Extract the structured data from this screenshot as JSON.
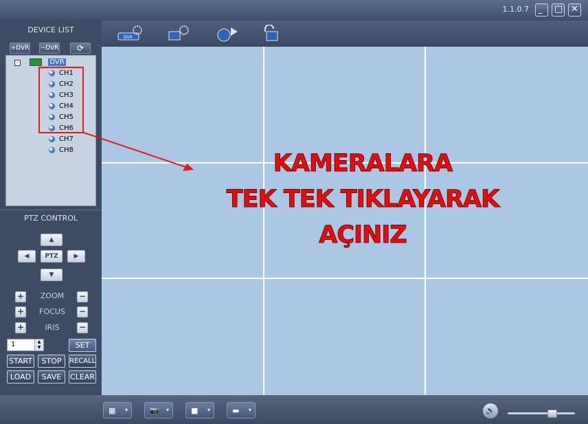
{
  "window": {
    "version": "1.1.0.7",
    "minimize_glyph": "_",
    "maximize_glyph": "□",
    "close_glyph": "✕"
  },
  "device_list": {
    "title": "DEVICE LIST",
    "add_label": "+DVR",
    "remove_label": "−DVR",
    "refresh_label": "⟳",
    "device": "DVR",
    "channels": [
      "CH1",
      "CH2",
      "CH3",
      "CH4",
      "CH5",
      "CH6",
      "CH7",
      "CH8"
    ]
  },
  "ptz": {
    "title": "PTZ CONTROL",
    "center_label": "PTZ",
    "up_glyph": "▲",
    "down_glyph": "▼",
    "left_glyph": "◀",
    "right_glyph": "▶",
    "zoom": "ZOOM",
    "focus": "FOCUS",
    "iris": "IRIS",
    "plus": "+",
    "minus": "−",
    "preset_value": "1",
    "set": "SET",
    "start": "START",
    "stop": "STOP",
    "recall": "RECALL",
    "load": "LOAD",
    "save": "SAVE",
    "clear": "CLEAR"
  },
  "overlay": {
    "line1": "KAMERALARA",
    "line2": "TEK TEK TIKLAYARAK",
    "line3": "AÇINIZ",
    "color": "#e40e0e"
  },
  "toolbar": {
    "icons": [
      "dvr-settings-icon",
      "remote-settings-icon",
      "playback-icon",
      "unlock-icon"
    ],
    "dvr_text": "DVR"
  },
  "bottom": {
    "dropdown_glyph": "▾",
    "layout_glyph": "▦",
    "snapshot_glyph": "📷",
    "record_glyph": "■",
    "display_glyph": "▬",
    "volume_glyph": "🔊"
  }
}
